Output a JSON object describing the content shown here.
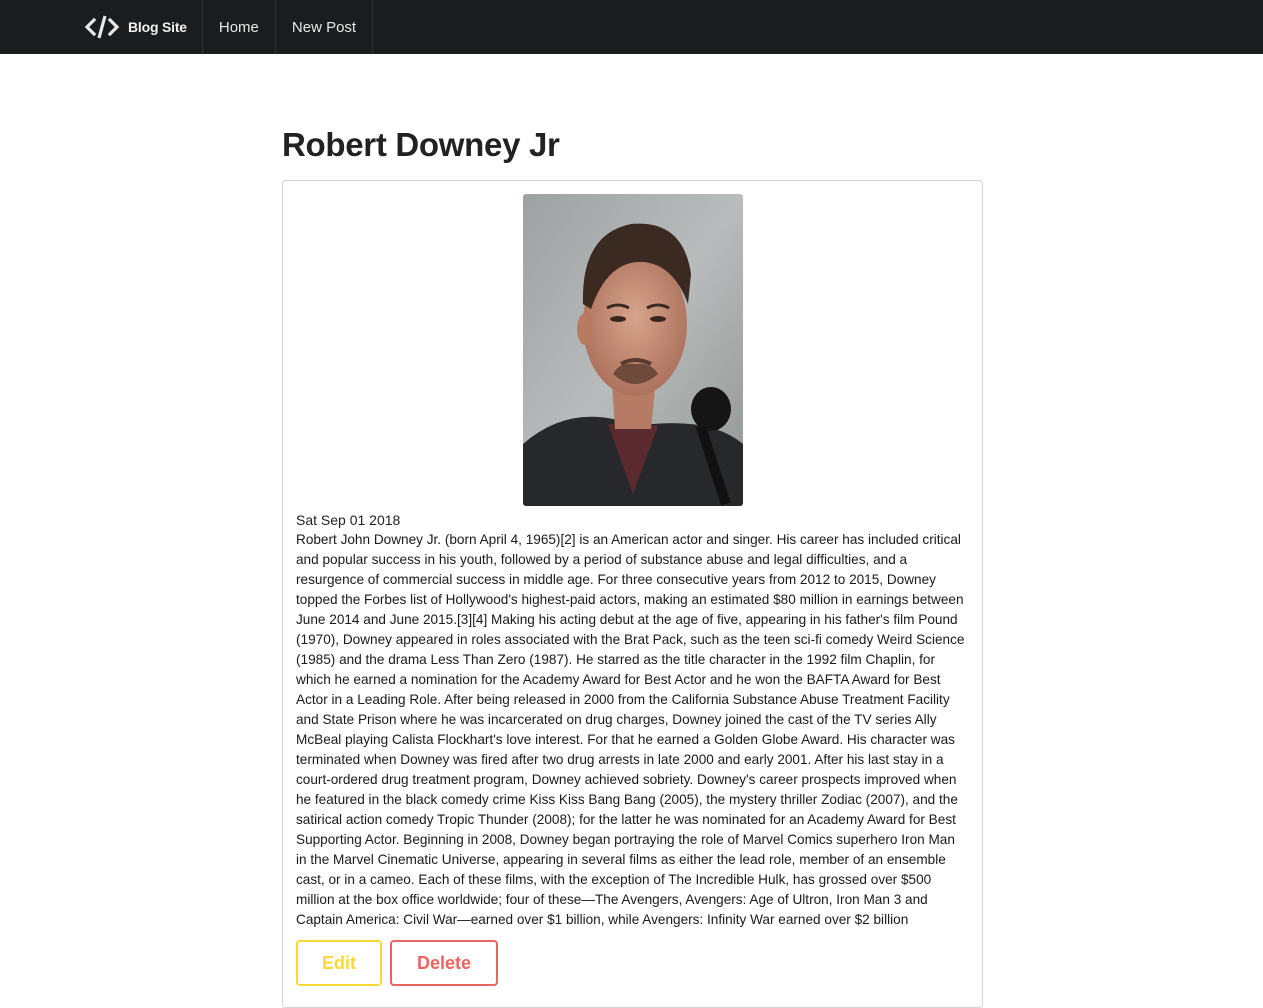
{
  "nav": {
    "brand": "Blog Site",
    "home": "Home",
    "new_post": "New Post"
  },
  "post": {
    "title": "Robert Downey Jr",
    "date": "Sat Sep 01 2018",
    "body": "Robert John Downey Jr. (born April 4, 1965)[2] is an American actor and singer. His career has included critical and popular success in his youth, followed by a period of substance abuse and legal difficulties, and a resurgence of commercial success in middle age. For three consecutive years from 2012 to 2015, Downey topped the Forbes list of Hollywood's highest-paid actors, making an estimated $80 million in earnings between June 2014 and June 2015.[3][4] Making his acting debut at the age of five, appearing in his father's film Pound (1970), Downey appeared in roles associated with the Brat Pack, such as the teen sci-fi comedy Weird Science (1985) and the drama Less Than Zero (1987). He starred as the title character in the 1992 film Chaplin, for which he earned a nomination for the Academy Award for Best Actor and he won the BAFTA Award for Best Actor in a Leading Role. After being released in 2000 from the California Substance Abuse Treatment Facility and State Prison where he was incarcerated on drug charges, Downey joined the cast of the TV series Ally McBeal playing Calista Flockhart's love interest. For that he earned a Golden Globe Award. His character was terminated when Downey was fired after two drug arrests in late 2000 and early 2001. After his last stay in a court-ordered drug treatment program, Downey achieved sobriety. Downey's career prospects improved when he featured in the black comedy crime Kiss Kiss Bang Bang (2005), the mystery thriller Zodiac (2007), and the satirical action comedy Tropic Thunder (2008); for the latter he was nominated for an Academy Award for Best Supporting Actor. Beginning in 2008, Downey began portraying the role of Marvel Comics superhero Iron Man in the Marvel Cinematic Universe, appearing in several films as either the lead role, member of an ensemble cast, or in a cameo. Each of these films, with the exception of The Incredible Hulk, has grossed over $500 million at the box office worldwide; four of these—The Avengers, Avengers: Age of Ultron, Iron Man 3 and Captain America: Civil War—earned over $1 billion, while Avengers: Infinity War earned over $2 billion"
  },
  "actions": {
    "edit": "Edit",
    "delete": "Delete"
  },
  "colors": {
    "navbar": "#1b1c1d",
    "edit": "#fbd834",
    "delete": "#e8665f"
  },
  "icons": {
    "brand": "code-icon"
  }
}
